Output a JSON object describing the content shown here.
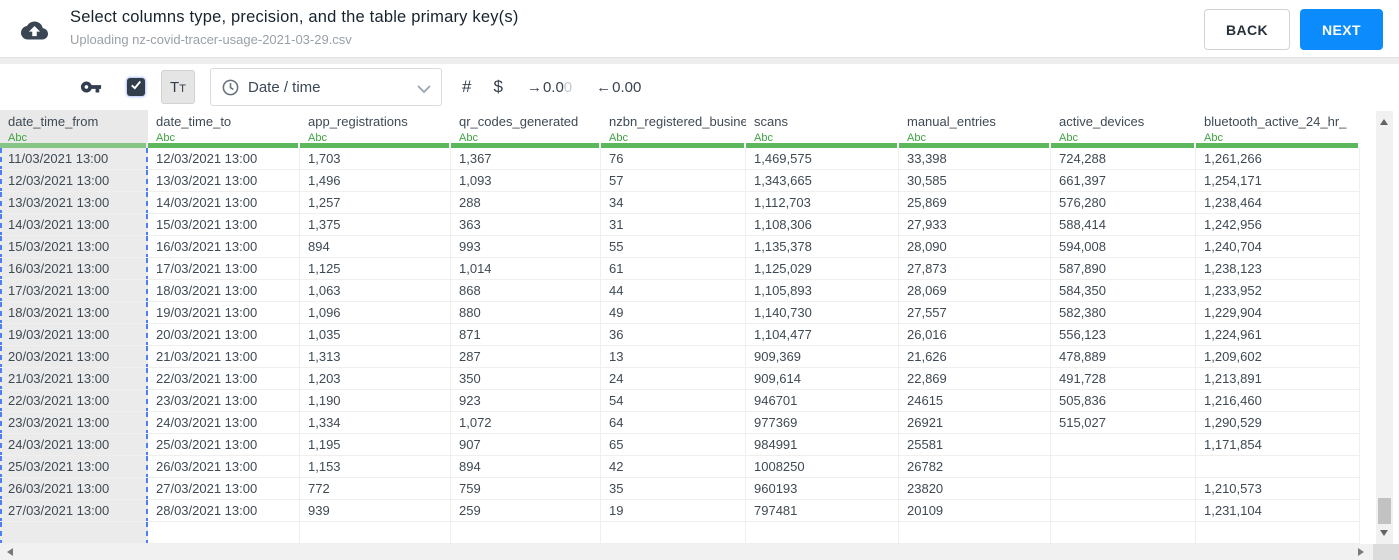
{
  "header": {
    "title": "Select columns type, precision, and the table primary key(s)",
    "subtitle": "Uploading nz-covid-tracer-usage-2021-03-29.csv",
    "back_label": "BACK",
    "next_label": "NEXT"
  },
  "toolbar": {
    "text_type_label": "Tt",
    "type_select": {
      "value": "Date / time"
    },
    "number_label": "#",
    "currency_label": "$",
    "increase_decimal": {
      "arrow": "→",
      "text": "0.0",
      "faded": "0"
    },
    "decrease_decimal": {
      "arrow": "←",
      "text": "0.00"
    }
  },
  "icons": {
    "upload": "cloud-upload-icon",
    "primary_key": "key-icon",
    "checkbox": "checkbox-checked-icon",
    "clock": "clock-icon",
    "chevron": "chevron-down-icon"
  },
  "colors": {
    "accent_blue": "#0c8cfc",
    "type_green": "#3fa33f",
    "bar_green": "#5db75d",
    "selection_dash_blue": "#4d7ef2",
    "selected_column_bg": "#ebebeb"
  },
  "table": {
    "type_label": "Abc",
    "selected_column_index": 0,
    "columns": [
      "date_time_from",
      "date_time_to",
      "app_registrations",
      "qr_codes_generated",
      "nzbn_registered_busine",
      "scans",
      "manual_entries",
      "active_devices",
      "bluetooth_active_24_hr_"
    ],
    "rows": [
      [
        "11/03/2021 13:00",
        "12/03/2021 13:00",
        "1,703",
        "1,367",
        "76",
        "1,469,575",
        "33,398",
        "724,288",
        "1,261,266"
      ],
      [
        "12/03/2021 13:00",
        "13/03/2021 13:00",
        "1,496",
        "1,093",
        "57",
        "1,343,665",
        "30,585",
        "661,397",
        "1,254,171"
      ],
      [
        "13/03/2021 13:00",
        "14/03/2021 13:00",
        "1,257",
        "288",
        "34",
        "1,112,703",
        "25,869",
        "576,280",
        "1,238,464"
      ],
      [
        "14/03/2021 13:00",
        "15/03/2021 13:00",
        "1,375",
        "363",
        "31",
        "1,108,306",
        "27,933",
        "588,414",
        "1,242,956"
      ],
      [
        "15/03/2021 13:00",
        "16/03/2021 13:00",
        "894",
        "993",
        "55",
        "1,135,378",
        "28,090",
        "594,008",
        "1,240,704"
      ],
      [
        "16/03/2021 13:00",
        "17/03/2021 13:00",
        "1,125",
        "1,014",
        "61",
        "1,125,029",
        "27,873",
        "587,890",
        "1,238,123"
      ],
      [
        "17/03/2021 13:00",
        "18/03/2021 13:00",
        "1,063",
        "868",
        "44",
        "1,105,893",
        "28,069",
        "584,350",
        "1,233,952"
      ],
      [
        "18/03/2021 13:00",
        "19/03/2021 13:00",
        "1,096",
        "880",
        "49",
        "1,140,730",
        "27,557",
        "582,380",
        "1,229,904"
      ],
      [
        "19/03/2021 13:00",
        "20/03/2021 13:00",
        "1,035",
        "871",
        "36",
        "1,104,477",
        "26,016",
        "556,123",
        "1,224,961"
      ],
      [
        "20/03/2021 13:00",
        "21/03/2021 13:00",
        "1,313",
        "287",
        "13",
        "909,369",
        "21,626",
        "478,889",
        "1,209,602"
      ],
      [
        "21/03/2021 13:00",
        "22/03/2021 13:00",
        "1,203",
        "350",
        "24",
        "909,614",
        "22,869",
        "491,728",
        "1,213,891"
      ],
      [
        "22/03/2021 13:00",
        "23/03/2021 13:00",
        "1,190",
        "923",
        "54",
        "946701",
        "24615",
        "505,836",
        "1,216,460"
      ],
      [
        "23/03/2021 13:00",
        "24/03/2021 13:00",
        "1,334",
        "1,072",
        "64",
        "977369",
        "26921",
        "515,027",
        "1,290,529"
      ],
      [
        "24/03/2021 13:00",
        "25/03/2021 13:00",
        "1,195",
        "907",
        "65",
        "984991",
        "25581",
        "",
        "1,171,854"
      ],
      [
        "25/03/2021 13:00",
        "26/03/2021 13:00",
        "1,153",
        "894",
        "42",
        "1008250",
        "26782",
        "",
        ""
      ],
      [
        "26/03/2021 13:00",
        "27/03/2021 13:00",
        "772",
        "759",
        "35",
        "960193",
        "23820",
        "",
        "1,210,573"
      ],
      [
        "27/03/2021 13:00",
        "28/03/2021 13:00",
        "939",
        "259",
        "19",
        "797481",
        "20109",
        "",
        "1,231,104"
      ]
    ]
  }
}
